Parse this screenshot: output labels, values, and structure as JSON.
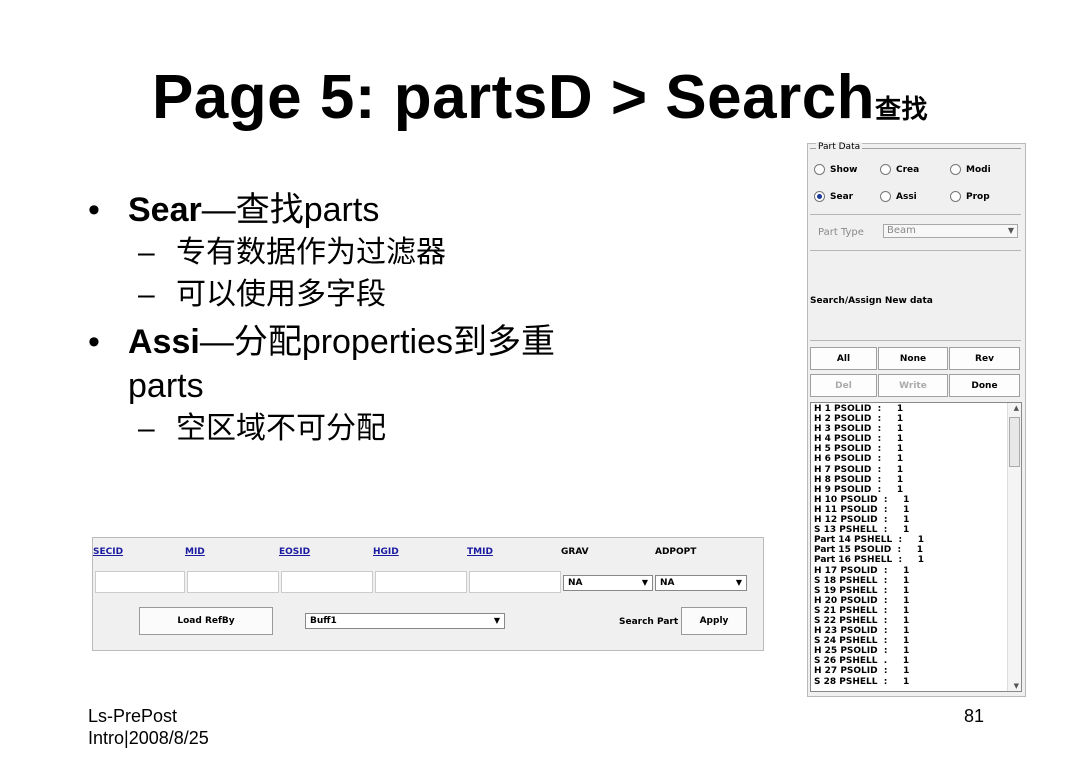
{
  "title": {
    "main": "Page 5: partsD > Search",
    "cn": "查找"
  },
  "bullets": [
    {
      "bold": "Sear",
      "rest": "—查找parts",
      "subs": [
        "专有数据作为过滤器",
        "可以使用多字段"
      ]
    },
    {
      "bold": "Assi",
      "rest": "—分配properties到多重",
      "cont": "parts",
      "subs": [
        "空区域不可分配"
      ]
    }
  ],
  "footer": {
    "left_line1": "Ls-PrePost",
    "left_line2": "Intro|2008/8/25",
    "page": "81"
  },
  "panel": {
    "legend": "Part Data",
    "radios": [
      {
        "label": "Show",
        "checked": false
      },
      {
        "label": "Crea",
        "checked": false
      },
      {
        "label": "Modi",
        "checked": false
      },
      {
        "label": "Sear",
        "checked": true
      },
      {
        "label": "Assi",
        "checked": false
      },
      {
        "label": "Prop",
        "checked": false
      }
    ],
    "part_type_label": "Part Type",
    "part_type_value": "Beam",
    "search_assign_label": "Search/Assign New data",
    "buttons": [
      "All",
      "None",
      "Rev",
      "Del",
      "Write",
      "Done"
    ],
    "list": [
      "H 1 PSOLID  :     1",
      "H 2 PSOLID  :     1",
      "H 3 PSOLID  :     1",
      "H 4 PSOLID  :     1",
      "H 5 PSOLID  :     1",
      "H 6 PSOLID  :     1",
      "H 7 PSOLID  :     1",
      "H 8 PSOLID  :     1",
      "H 9 PSOLID  :     1",
      "H 10 PSOLID  :     1",
      "H 11 PSOLID  :     1",
      "H 12 PSOLID  :     1",
      "S 13 PSHELL  :     1",
      "Part 14 PSHELL  :     1",
      "Part 15 PSOLID  :     1",
      "Part 16 PSHELL  :     1",
      "H 17 PSOLID  :     1",
      "S 18 PSHELL  :     1",
      "S 19 PSHELL  :     1",
      "H 20 PSOLID  :     1",
      "S 21 PSHELL  :     1",
      "S 22 PSHELL  :     1",
      "H 23 PSOLID  :     1",
      "S 24 PSHELL  :     1",
      "H 25 PSOLID  :     1",
      "S 26 PSHELL  .     1",
      "H 27 PSOLID  :     1",
      "S 28 PSHELL  :     1"
    ]
  },
  "toolbar": {
    "headers": [
      "SECID",
      "MID",
      "EOSID",
      "HGID",
      "TMID",
      "GRAV",
      "ADPOPT"
    ],
    "grav_value": "NA",
    "adpopt_value": "NA",
    "load_button": "Load RefBy",
    "buffer_value": "Buff1",
    "search_part_label": "Search Part",
    "apply_button": "Apply"
  }
}
